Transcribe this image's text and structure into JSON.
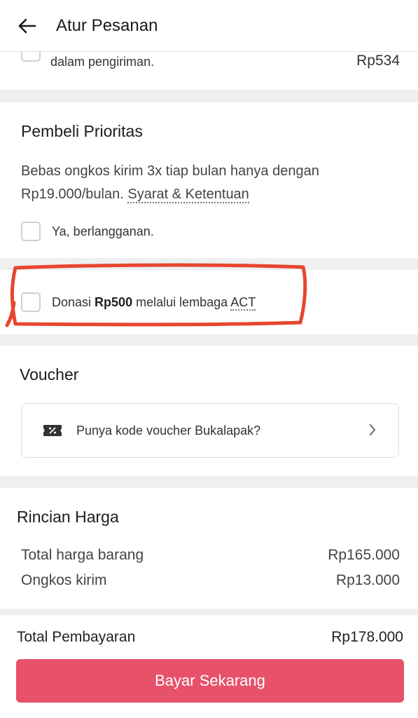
{
  "header": {
    "title": "Atur Pesanan",
    "back_icon": "arrow-left-icon"
  },
  "partial_row": {
    "label": "dalam pengiriman.",
    "price": "Rp534"
  },
  "prioritas": {
    "title": "Pembeli Prioritas",
    "description_prefix": "Bebas ongkos kirim 3x tiap bulan hanya dengan Rp19.000/bulan.",
    "terms_link": "Syarat & Ketentuan",
    "subscribe_label": "Ya, berlangganan."
  },
  "donasi": {
    "prefix": "Donasi",
    "amount": "Rp500",
    "middle": "melalui lembaga",
    "org": "ACT",
    "annotation_color": "#e8452f"
  },
  "voucher": {
    "title": "Voucher",
    "input_label": "Punya kode voucher Bukalapak?",
    "icon": "voucher-percent-icon"
  },
  "rincian": {
    "title": "Rincian Harga",
    "rows": [
      {
        "label": "Total harga barang",
        "value": "Rp165.000"
      },
      {
        "label": "Ongkos kirim",
        "value": "Rp13.000"
      }
    ]
  },
  "summary": {
    "total_label": "Total Pembayaran",
    "total_value": "Rp178.000",
    "pay_button": "Bayar Sekarang",
    "accent": "#e7526a"
  }
}
